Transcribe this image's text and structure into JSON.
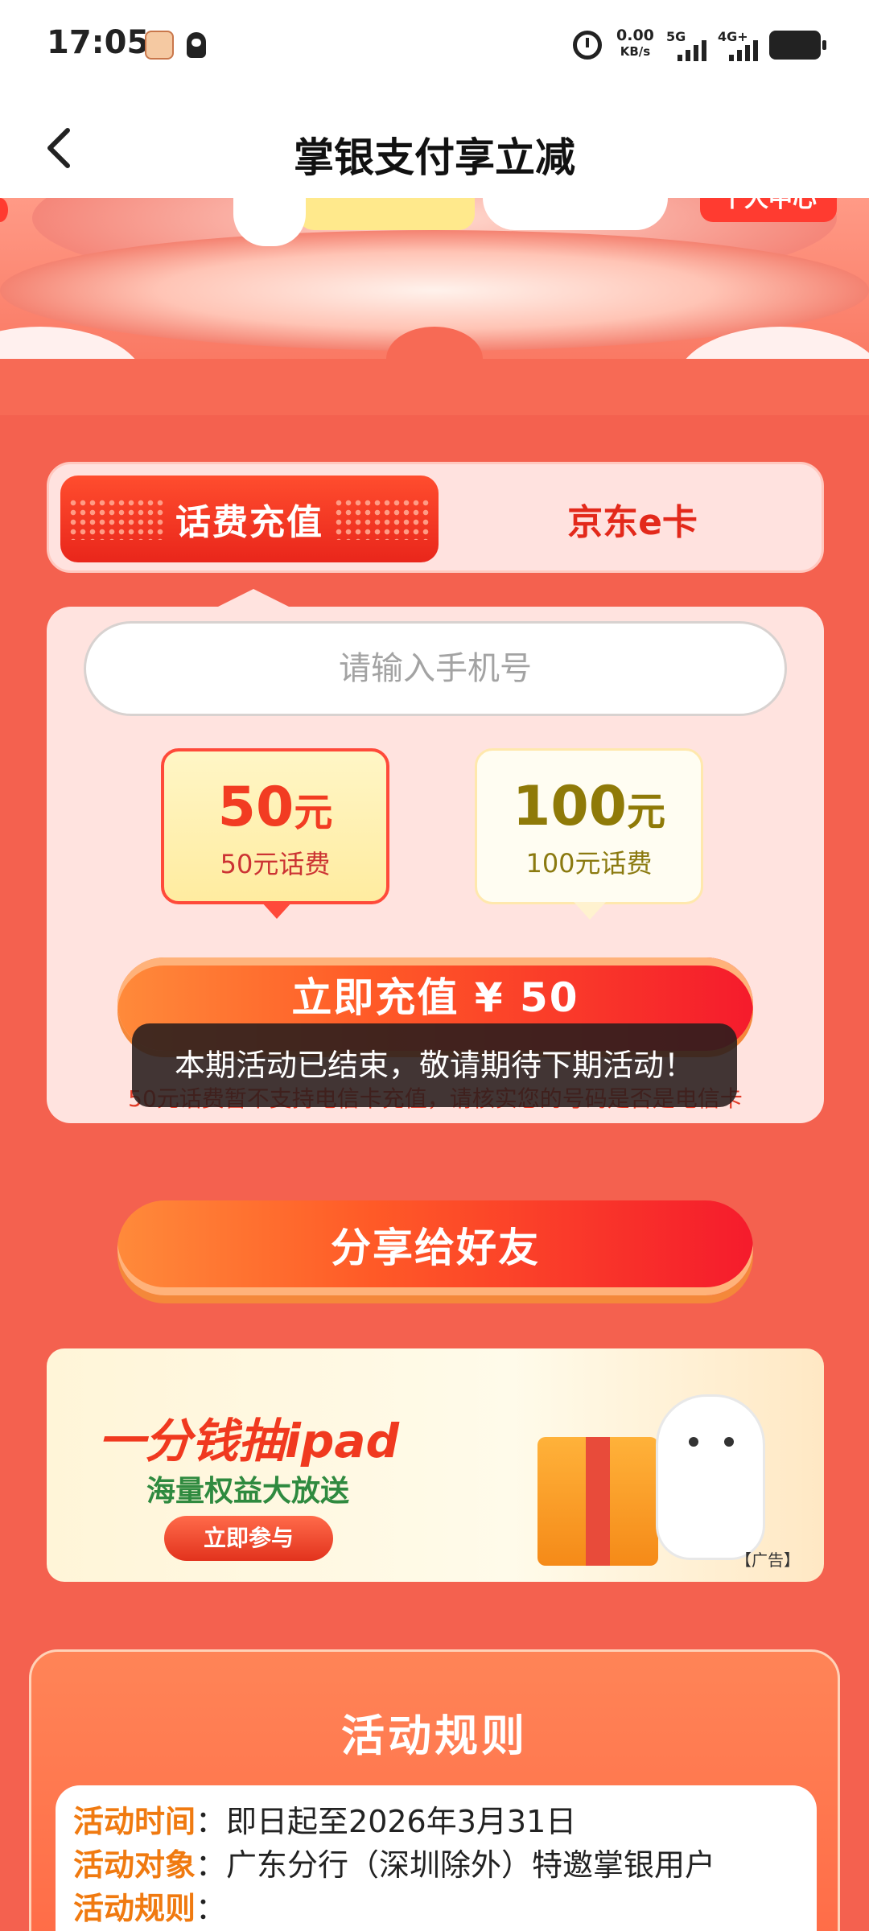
{
  "status_bar": {
    "time": "17:05",
    "net_speed": "0.00",
    "net_unit": "KB/s",
    "sig1_label": "5G",
    "sig2_label": "4G+"
  },
  "nav": {
    "back_icon": "chevron-left-icon",
    "title": "掌银支付享立减"
  },
  "hero": {
    "badge": "个人中心"
  },
  "tabs": [
    {
      "label": "话费充值",
      "active": true
    },
    {
      "label": "京东e卡",
      "active": false
    }
  ],
  "recharge": {
    "phone_placeholder": "请输入手机号",
    "options": [
      {
        "amount": "50",
        "unit": "元",
        "desc": "50元话费",
        "selected": true
      },
      {
        "amount": "100",
        "unit": "元",
        "desc": "100元话费",
        "selected": false
      }
    ],
    "pay_button": "立即充值 ¥ 50",
    "note": "50元话费暂不支持电信卡充值，请核实您的号码是否是电信卡"
  },
  "toast": "本期活动已结束，敬请期待下期活动！",
  "share_button": "分享给好友",
  "ad": {
    "title": "一分钱抽ipad",
    "subtitle": "海量权益大放送",
    "button": "立即参与",
    "tag": "【广告】"
  },
  "rules": {
    "title": "活动规则",
    "rows": [
      {
        "key": "活动时间",
        "value": "即日起至2026年3月31日"
      },
      {
        "key": "活动对象",
        "value": "广东分行（深圳除外）特邀掌银用户"
      },
      {
        "key": "活动规则",
        "value": ""
      }
    ]
  },
  "colors": {
    "page_bg": "#f4614f",
    "accent_red": "#e3291b",
    "rule_key": "#f07a10"
  }
}
